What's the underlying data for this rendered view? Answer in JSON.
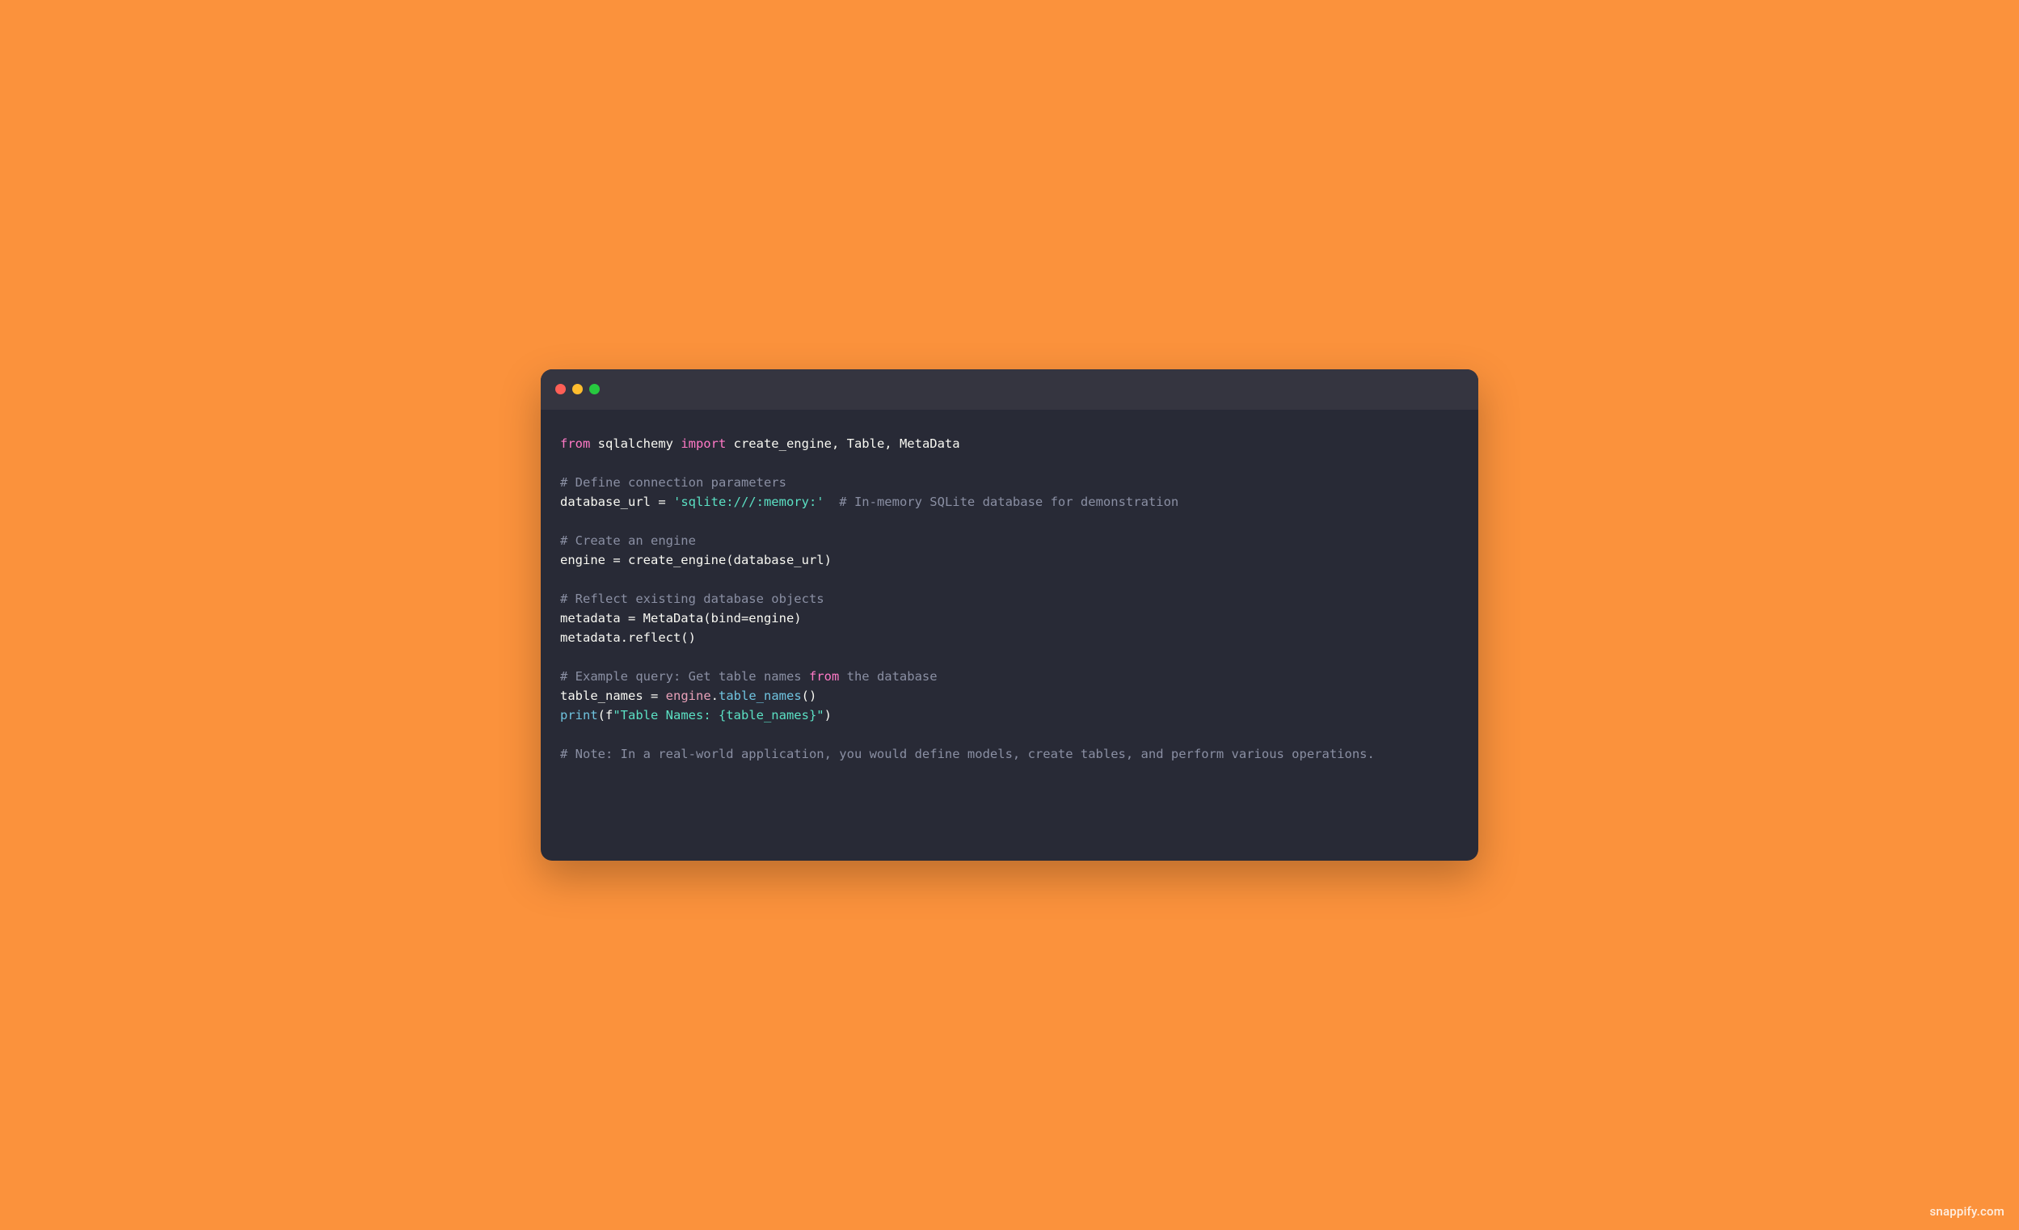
{
  "watermark": "snappify.com",
  "code": {
    "lines": [
      {
        "segments": [
          {
            "text": "from",
            "cls": "tok-keyword"
          },
          {
            "text": " sqlalchemy "
          },
          {
            "text": "import",
            "cls": "tok-keyword"
          },
          {
            "text": " create_engine, Table, MetaData"
          }
        ]
      },
      {
        "segments": [
          {
            "text": ""
          }
        ]
      },
      {
        "segments": [
          {
            "text": "# Define connection parameters",
            "cls": "tok-comment"
          }
        ]
      },
      {
        "segments": [
          {
            "text": "database_url = "
          },
          {
            "text": "'sqlite:///:memory:'",
            "cls": "tok-string"
          },
          {
            "text": "  "
          },
          {
            "text": "# In-memory SQLite database for demonstration",
            "cls": "tok-comment"
          }
        ]
      },
      {
        "segments": [
          {
            "text": ""
          }
        ]
      },
      {
        "segments": [
          {
            "text": "# Create an engine",
            "cls": "tok-comment"
          }
        ]
      },
      {
        "segments": [
          {
            "text": "engine = create_engine(database_url)"
          }
        ]
      },
      {
        "segments": [
          {
            "text": ""
          }
        ]
      },
      {
        "segments": [
          {
            "text": "# Reflect existing database objects",
            "cls": "tok-comment"
          }
        ]
      },
      {
        "segments": [
          {
            "text": "metadata = MetaData(bind=engine)"
          }
        ]
      },
      {
        "segments": [
          {
            "text": "metadata.reflect()"
          }
        ]
      },
      {
        "segments": [
          {
            "text": ""
          }
        ]
      },
      {
        "segments": [
          {
            "text": "# Example query: Get table names ",
            "cls": "tok-comment"
          },
          {
            "text": "from",
            "cls": "tok-keyword"
          },
          {
            "text": " the database",
            "cls": "tok-comment"
          }
        ]
      },
      {
        "segments": [
          {
            "text": "table_names = "
          },
          {
            "text": "engine",
            "cls": "tok-prop"
          },
          {
            "text": "."
          },
          {
            "text": "table_names",
            "cls": "tok-builtin"
          },
          {
            "text": "()"
          }
        ]
      },
      {
        "segments": [
          {
            "text": "print",
            "cls": "tok-builtin"
          },
          {
            "text": "(f"
          },
          {
            "text": "\"Table Names: {table_names}\"",
            "cls": "tok-string"
          },
          {
            "text": ")"
          }
        ]
      },
      {
        "segments": [
          {
            "text": ""
          }
        ]
      },
      {
        "segments": [
          {
            "text": "# Note: In a real-world application, you would define models, create tables, and perform various operations.",
            "cls": "tok-comment"
          }
        ]
      }
    ]
  }
}
